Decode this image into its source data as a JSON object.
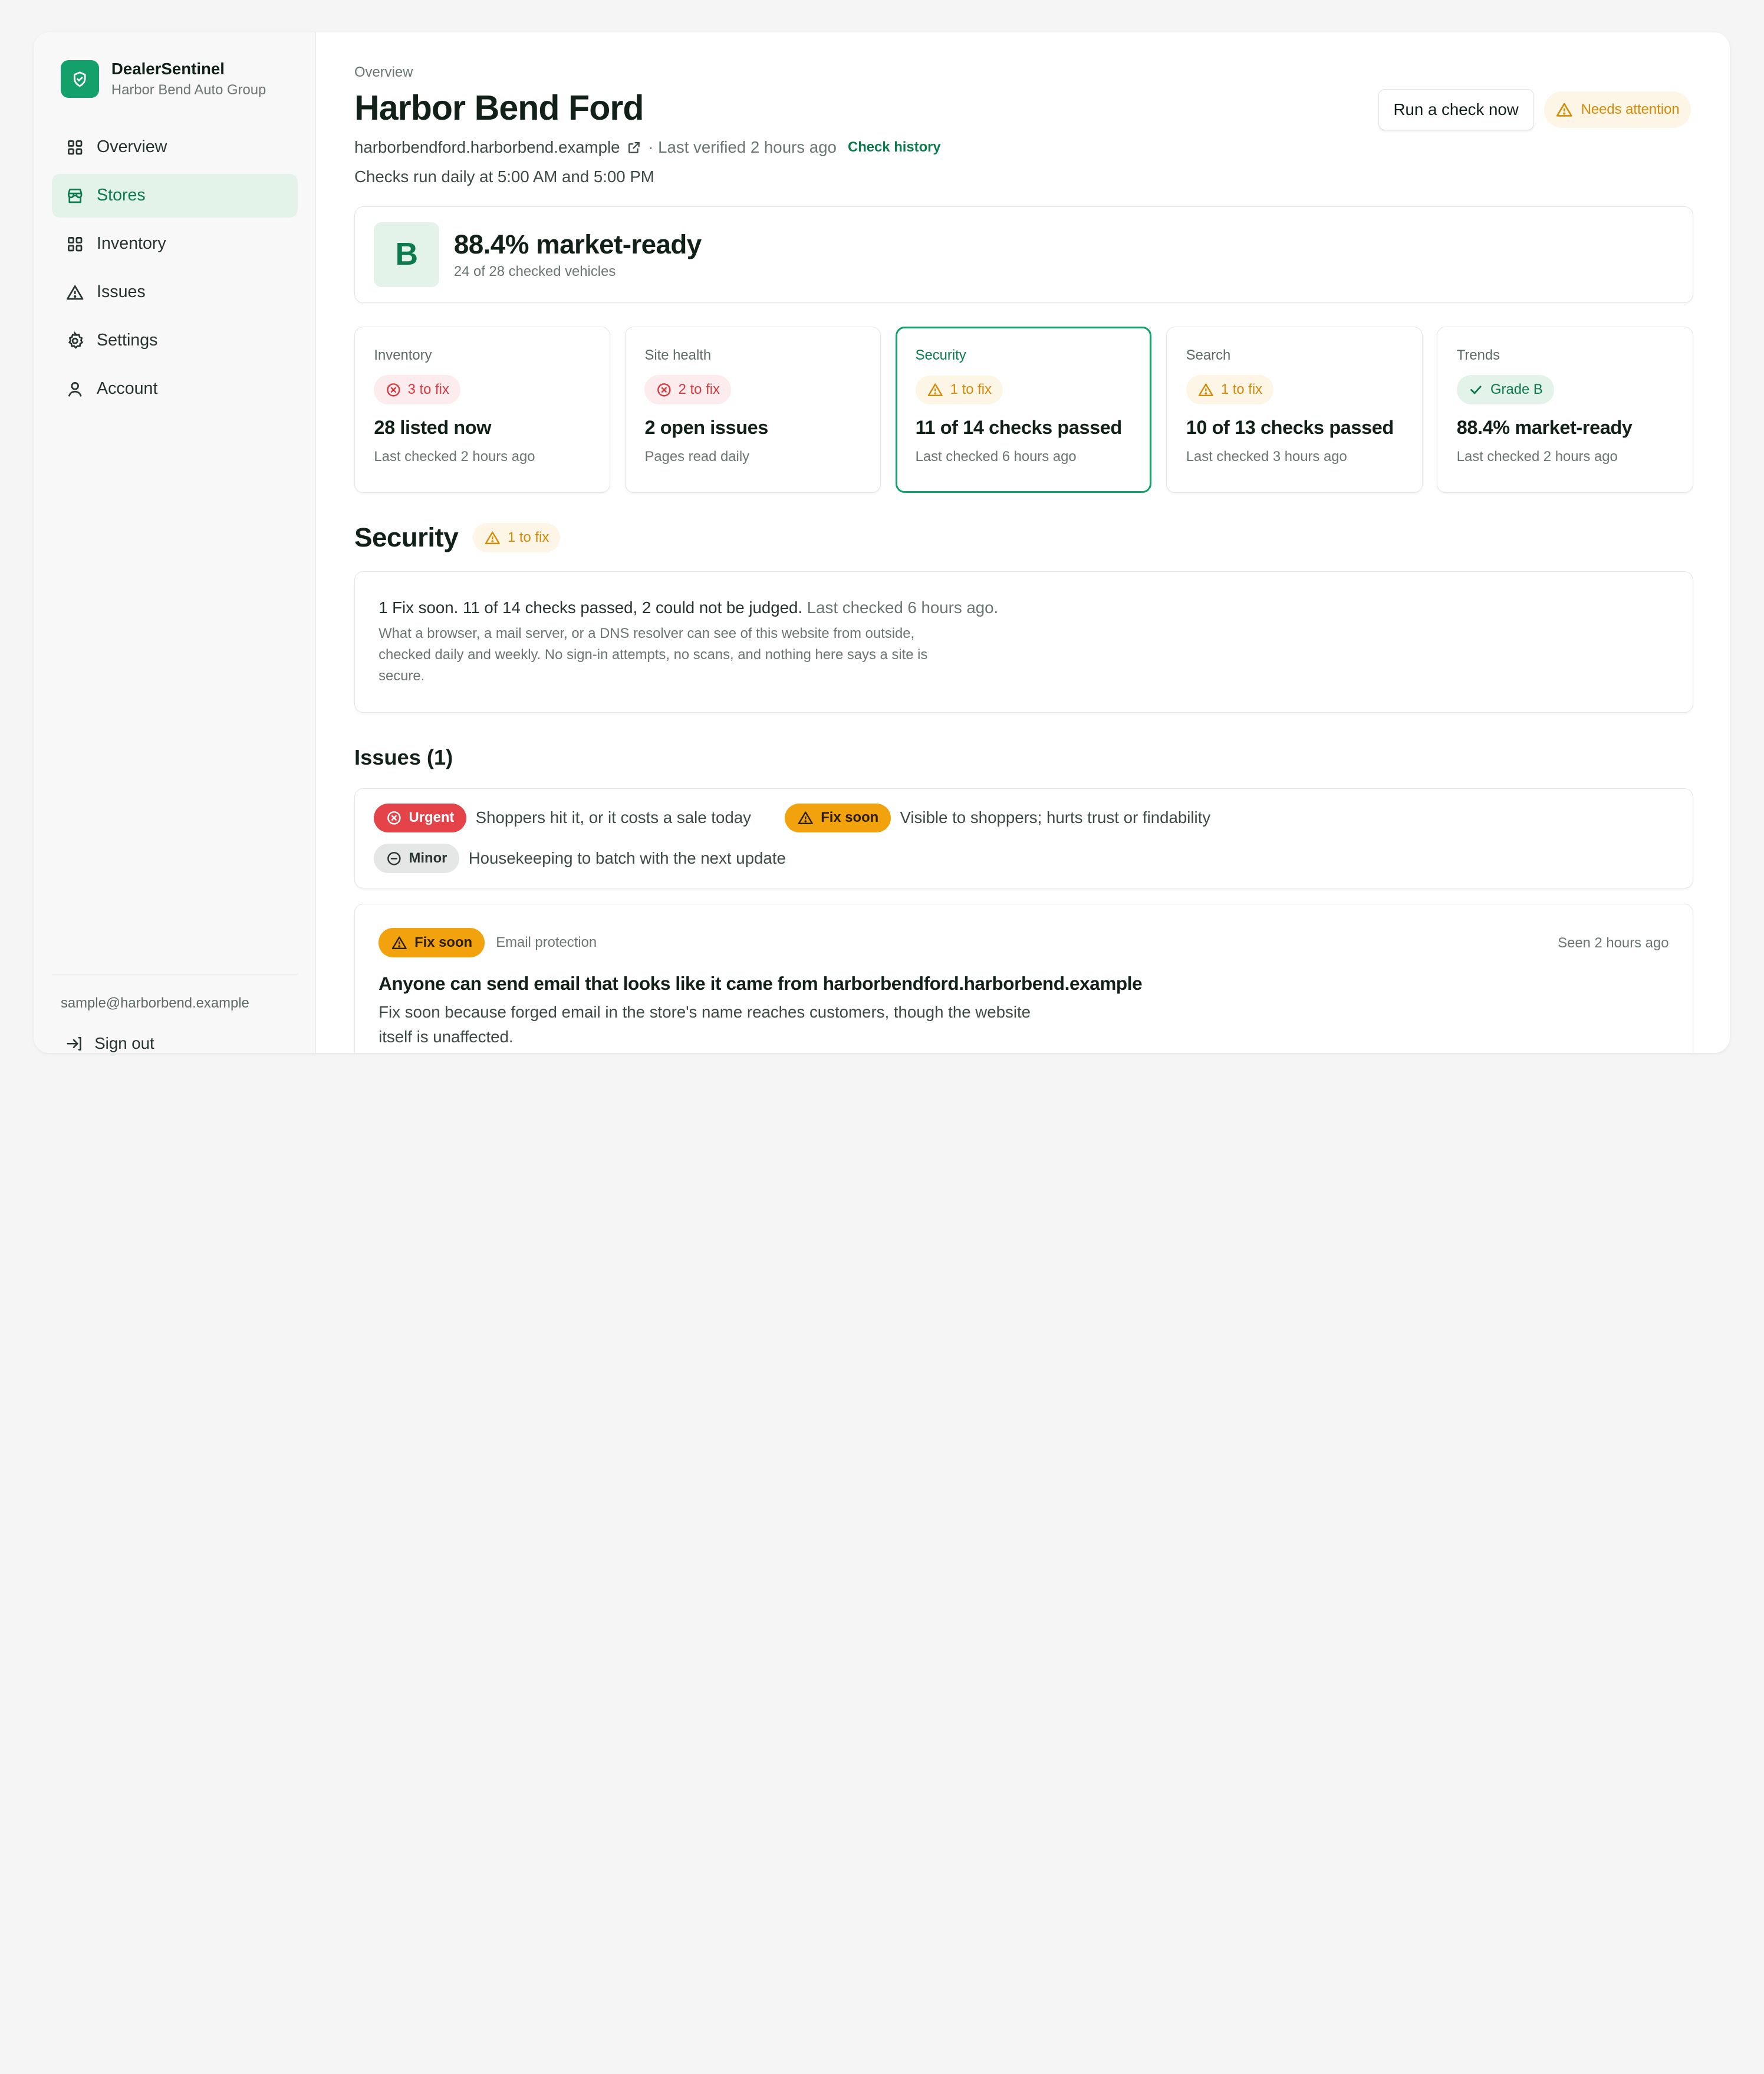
{
  "brand": {
    "name": "DealerSentinel",
    "subtitle": "Harbor Bend Auto Group",
    "icon": "shield-check-icon",
    "color": "#14a06b"
  },
  "nav": [
    {
      "label": "Overview",
      "icon": "grid-icon",
      "active": false
    },
    {
      "label": "Stores",
      "icon": "store-icon",
      "active": true
    },
    {
      "label": "Inventory",
      "icon": "grid-icon",
      "active": false
    },
    {
      "label": "Issues",
      "icon": "warning-icon",
      "active": false
    },
    {
      "label": "Settings",
      "icon": "gear-icon",
      "active": false
    },
    {
      "label": "Account",
      "icon": "user-icon",
      "active": false
    }
  ],
  "footer": {
    "email": "sample@harborbend.example",
    "signout": "Sign out"
  },
  "header": {
    "breadcrumb": "Overview",
    "title": "Harbor Bend Ford",
    "domain": "harborbendford.harborbend.example",
    "verified": "· Last verified 2 hours ago",
    "history_link": "Check history",
    "schedule": "Checks run daily at 5:00 AM and 5:00 PM",
    "run_button": "Run a check now",
    "status": "Needs attention"
  },
  "score": {
    "grade": "B",
    "headline": "88.4% market-ready",
    "detail": "24 of 28 checked vehicles"
  },
  "cards": [
    {
      "label": "Inventory",
      "chip": "3 to fix",
      "chip_tone": "red",
      "value": "28 listed now",
      "sub": "Last checked 2 hours ago"
    },
    {
      "label": "Site health",
      "chip": "2 to fix",
      "chip_tone": "red",
      "value": "2 open issues",
      "sub": "Pages read daily"
    },
    {
      "label": "Security",
      "chip": "1 to fix",
      "chip_tone": "amber",
      "value": "11 of 14 checks passed",
      "sub": "Last checked 6 hours ago",
      "selected": true
    },
    {
      "label": "Search",
      "chip": "1 to fix",
      "chip_tone": "amber",
      "value": "10 of 13 checks passed",
      "sub": "Last checked 3 hours ago"
    },
    {
      "label": "Trends",
      "chip": "Grade B",
      "chip_tone": "green",
      "value": "88.4% market-ready",
      "sub": "Last checked 2 hours ago"
    }
  ],
  "security": {
    "title": "Security",
    "chip": "1 to fix",
    "summary": "1 Fix soon. 11 of 14 checks passed, 2 could not be judged.",
    "summary_time": "Last checked 6 hours ago.",
    "description": "What a browser, a mail server, or a DNS resolver can see of this website from outside, checked daily and weekly. No sign-in attempts, no scans, and nothing here says a site is secure."
  },
  "issues": {
    "title": "Issues (1)",
    "legend": {
      "urgent_label": "Urgent",
      "urgent_text": "Shoppers hit it, or it costs a sale today",
      "fix_label": "Fix soon",
      "fix_text": "Visible to shoppers; hurts trust or findability",
      "minor_label": "Minor",
      "minor_text": "Housekeeping to batch with the next update"
    },
    "item": {
      "severity": "Fix soon",
      "category": "Email protection",
      "seen": "Seen 2 hours ago",
      "title": "Anyone can send email that looks like it came from harborbendford.harborbend.example",
      "description": "Fix soon because forged email in the store's name reaches customers, though the website itself is unaffected."
    }
  },
  "colors": {
    "accent": "#14a06b",
    "urgent": "#e34349",
    "fix_soon": "#f2a20d",
    "attention": "#d58a06"
  }
}
